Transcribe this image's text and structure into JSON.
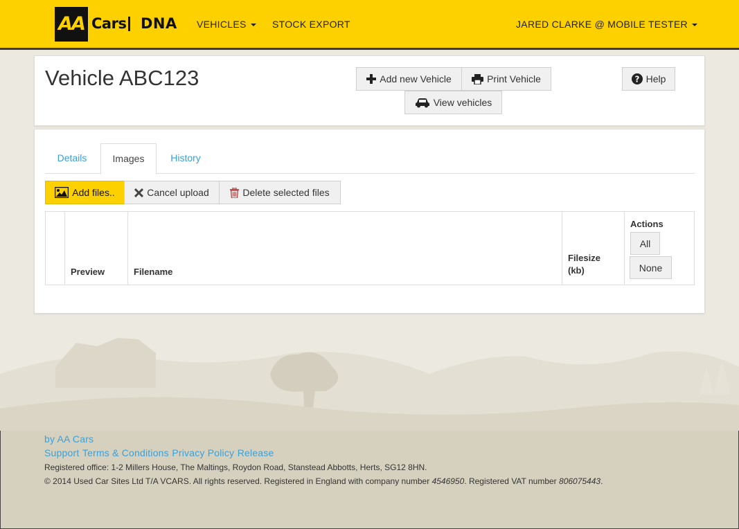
{
  "navbar": {
    "logo_text": "AA",
    "brand_cars": "Cars",
    "brand_dna": "DNA",
    "vehicles_label": "VEHICLES",
    "stock_export_label": "STOCK EXPORT",
    "user_label": "JARED CLARKE @ MOBILE TESTER",
    "brand_color": "#fdd000"
  },
  "header": {
    "title": "Vehicle ABC123",
    "add_vehicle_label": "Add new Vehicle",
    "print_vehicle_label": "Print Vehicle",
    "view_vehicles_label": "View vehicles",
    "help_label": "Help"
  },
  "tabs": [
    {
      "label": "Details",
      "active": false
    },
    {
      "label": "Images",
      "active": true
    },
    {
      "label": "History",
      "active": false
    }
  ],
  "upload": {
    "add_files_label": "Add files..",
    "cancel_upload_label": "Cancel upload",
    "delete_selected_label": "Delete selected files"
  },
  "table": {
    "headers": {
      "preview": "Preview",
      "filename": "Filename",
      "filesize_line1": "Filesize",
      "filesize_line2": "(kb)",
      "actions": "Actions"
    },
    "select_all_label": "All",
    "select_none_label": "None",
    "rows": []
  },
  "footer": {
    "by_label": "by AA Cars",
    "links": [
      "Support",
      "Terms & Conditions",
      "Privacy Policy",
      "Release"
    ],
    "registered_office": "Registered office: 1-2 Millers House, The Maltings, Roydon Road, Stanstead Abbotts, Herts, SG12 8HN.",
    "copyright_prefix": "© 2014 Used Car Sites Ltd T/A VCARS. All rights reserved. Registered in England with company number ",
    "company_number": "4546950",
    "vat_prefix": ". Registered VAT number ",
    "vat_number": "806075443",
    "end": "."
  },
  "icons": {
    "plus": "plus-icon",
    "print": "print-icon",
    "car": "car-icon",
    "help": "question-circle-icon",
    "image": "image-icon",
    "cancel": "times-icon",
    "trash": "trash-icon"
  }
}
